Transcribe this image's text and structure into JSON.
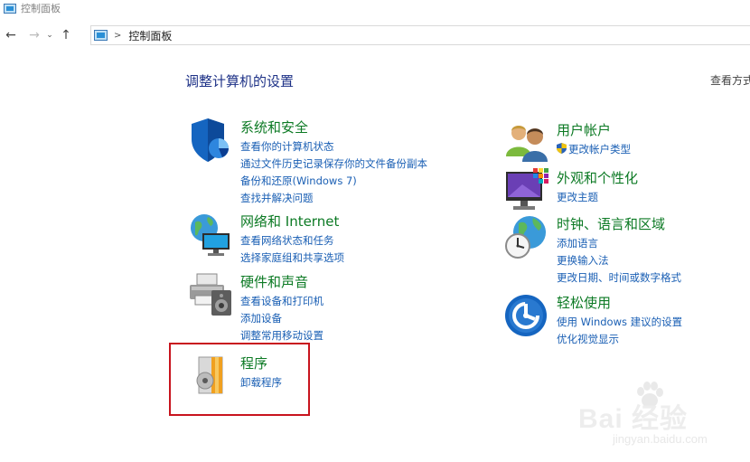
{
  "window": {
    "title": "控制面板"
  },
  "nav": {
    "back": "←",
    "forward": "→",
    "recent": "⌄",
    "up": "↑"
  },
  "address": {
    "separator": ">",
    "path": "控制面板"
  },
  "page": {
    "title": "调整计算机的设置",
    "view_by": "查看方式"
  },
  "categories": [
    {
      "title": "系统和安全",
      "links": [
        "查看你的计算机状态",
        "通过文件历史记录保存你的文件备份副本",
        "备份和还原(Windows 7)",
        "查找并解决问题"
      ]
    },
    {
      "title": "网络和 Internet",
      "links": [
        "查看网络状态和任务",
        "选择家庭组和共享选项"
      ]
    },
    {
      "title": "硬件和声音",
      "links": [
        "查看设备和打印机",
        "添加设备",
        "调整常用移动设置"
      ]
    },
    {
      "title": "程序",
      "links": [
        "卸载程序"
      ]
    },
    {
      "title": "用户帐户",
      "links": [
        "更改帐户类型"
      ]
    },
    {
      "title": "外观和个性化",
      "links": [
        "更改主题"
      ]
    },
    {
      "title": "时钟、语言和区域",
      "links": [
        "添加语言",
        "更换输入法",
        "更改日期、时间或数字格式"
      ]
    },
    {
      "title": "轻松使用",
      "links": [
        "使用 Windows 建议的设置",
        "优化视觉显示"
      ]
    }
  ],
  "watermark": {
    "main": "Bai 经验",
    "sub": "jingyan.baidu.com"
  },
  "colors": {
    "category_title": "#0c7a24",
    "link": "#1a5fb4",
    "page_title": "#1e3287",
    "highlight": "#c8141e"
  }
}
